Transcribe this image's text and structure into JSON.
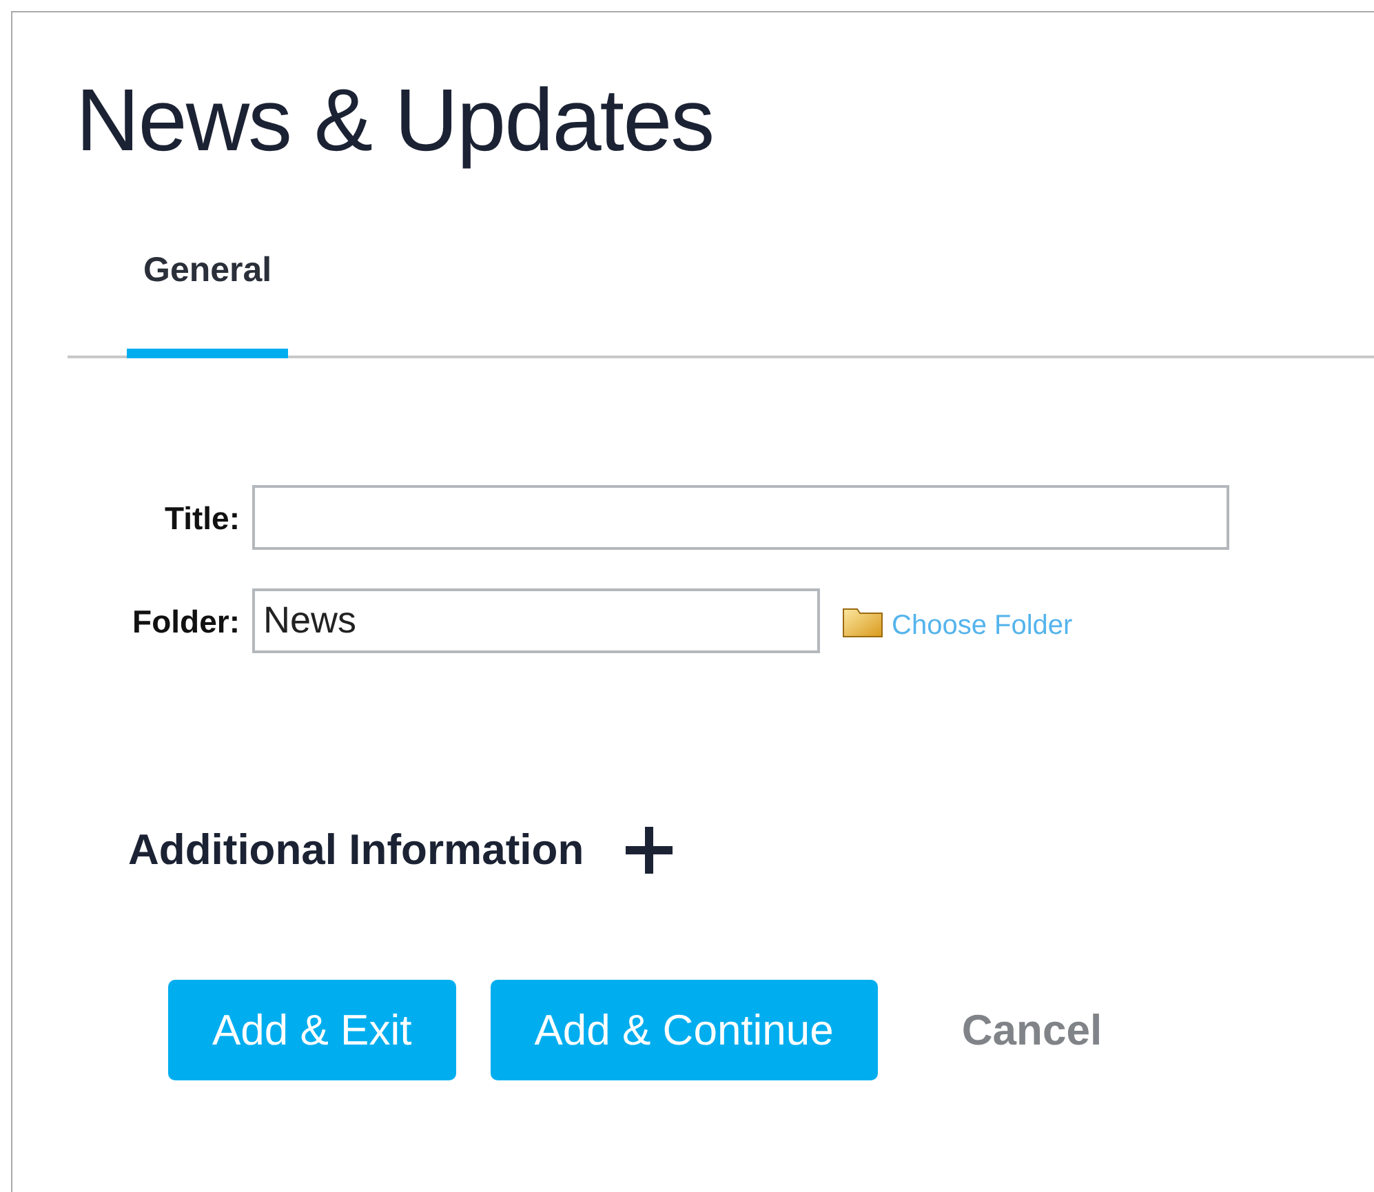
{
  "page_title": "News & Updates",
  "tabs": [
    {
      "label": "General",
      "selected": true
    }
  ],
  "fields": [
    {
      "label": "Title:",
      "kind": "long"
    },
    {
      "label": "Folder:",
      "value": "News",
      "kind": "folder",
      "link": "Choose Folder"
    }
  ],
  "section": {
    "label": "Additional Information",
    "expanded": false
  },
  "buttons": [
    {
      "label": "Add & Exit",
      "kind": "primary"
    },
    {
      "label": "Add & Continue",
      "kind": "primary"
    },
    {
      "label": "Cancel",
      "kind": "link"
    }
  ]
}
